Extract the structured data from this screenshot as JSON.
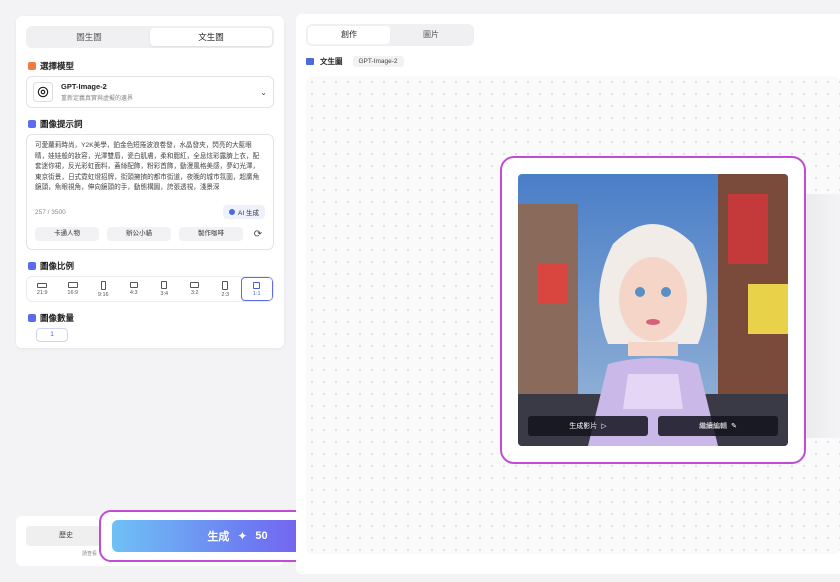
{
  "left": {
    "mode_tabs": [
      "圖生圖",
      "文生圖"
    ],
    "model_section_title": "選擇模型",
    "model": {
      "name": "GPT-Image-2",
      "desc": "重新定義真實與虛擬的邊界"
    },
    "prompt_section_title": "圖像提示詞",
    "prompt_text": "可愛蘿莉時尚，Y2K美學，鉑金色短捲波浪卷發，水晶發夾，閃亮的大藍眼睛，娃娃般的妝容，光澤雙唇，瓷白肌膚，柔和腮紅，全息炫彩露臍上衣，配套迷你裙，反光彩虹面料，蓋絲配飾，粉彩首飾，動漫風格美感，夢幻光澤，東京街景，日式霓虹燈招牌，街頭擁擠的都市街道，夜晚的城市氛圍，超廣角鏡頭，魚眼視角，伸向鏡頭的手，動態構圖，誇張透視，淺景深",
    "char_count": "257 / 3500",
    "ai_button": "AI 生成",
    "chips": [
      "卡通人物",
      "辦公小貓",
      "製作咖啡"
    ],
    "ratio_section_title": "圖像比例",
    "ratios": [
      "21:9",
      "16:9",
      "9:16",
      "4:3",
      "3:4",
      "3:2",
      "2:3",
      "1:1"
    ],
    "active_ratio": "1:1",
    "count_section_title": "圖像數量",
    "count_value": "1"
  },
  "bottom": {
    "history_button": "歷史",
    "note": "請查看",
    "generate_label": "生成",
    "generate_cost": "50",
    "generate_gradient": [
      "#6ec1f5",
      "#6d7cf2",
      "#7f46ee"
    ]
  },
  "right": {
    "tabs": [
      "創作",
      "圖片"
    ],
    "crumb_label": "文生圖",
    "crumb_tag": "GPT-Image-2",
    "overlay_buttons": [
      "生成影片",
      "繼續編輯"
    ]
  },
  "colors": {
    "highlight": "#c04bd4",
    "accent": "#5b6cf0"
  }
}
